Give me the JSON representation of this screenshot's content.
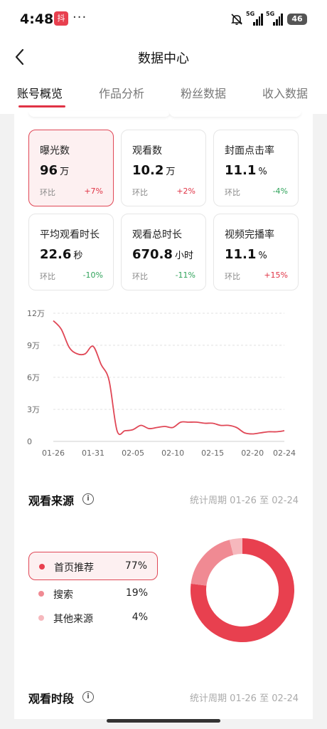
{
  "status_bar": {
    "time": "4:48",
    "app_badge": "抖",
    "more": "···",
    "network_1": "5G",
    "network_2": "5G",
    "battery": "46"
  },
  "nav": {
    "title": "数据中心"
  },
  "tabs": [
    {
      "label": "账号概览",
      "active": true
    },
    {
      "label": "作品分析",
      "active": false
    },
    {
      "label": "粉丝数据",
      "active": false
    },
    {
      "label": "收入数据",
      "active": false
    }
  ],
  "metrics": [
    {
      "label": "曝光数",
      "value": "96",
      "unit": "万",
      "compare_label": "环比",
      "change": "+7%",
      "trend": "up",
      "selected": true
    },
    {
      "label": "观看数",
      "value": "10.2",
      "unit": "万",
      "compare_label": "环比",
      "change": "+2%",
      "trend": "up",
      "selected": false
    },
    {
      "label": "封面点击率",
      "value": "11.1",
      "unit": "%",
      "compare_label": "环比",
      "change": "-4%",
      "trend": "down",
      "selected": false
    },
    {
      "label": "平均观看时长",
      "value": "22.6",
      "unit": "秒",
      "compare_label": "环比",
      "change": "-10%",
      "trend": "down",
      "selected": false
    },
    {
      "label": "观看总时长",
      "value": "670.8",
      "unit": "小时",
      "compare_label": "环比",
      "change": "-11%",
      "trend": "down",
      "selected": false
    },
    {
      "label": "视频完播率",
      "value": "11.1",
      "unit": "%",
      "compare_label": "环比",
      "change": "+15%",
      "trend": "up",
      "selected": false
    }
  ],
  "chart_data": {
    "type": "line",
    "ylim": [
      0,
      120000
    ],
    "y_ticks": [
      "0",
      "3万",
      "6万",
      "9万",
      "12万"
    ],
    "x_ticks": [
      "01-26",
      "01-31",
      "02-05",
      "02-10",
      "02-15",
      "02-20",
      "02-24"
    ],
    "grid": true,
    "color": "#e04756",
    "x": [
      "01-26",
      "01-27",
      "01-28",
      "01-29",
      "01-30",
      "01-31",
      "02-01",
      "02-02",
      "02-03",
      "02-04",
      "02-05",
      "02-06",
      "02-07",
      "02-08",
      "02-09",
      "02-10",
      "02-11",
      "02-12",
      "02-13",
      "02-14",
      "02-15",
      "02-16",
      "02-17",
      "02-18",
      "02-19",
      "02-20",
      "02-21",
      "02-22",
      "02-23",
      "02-24"
    ],
    "values": [
      113000,
      105000,
      88000,
      82000,
      82000,
      89000,
      72000,
      57000,
      10000,
      10000,
      11000,
      15000,
      12000,
      13000,
      14000,
      13000,
      18000,
      18000,
      18000,
      17000,
      17000,
      15000,
      15000,
      13000,
      8000,
      7000,
      8000,
      9000,
      9000,
      10000
    ]
  },
  "source_section": {
    "title": "观看来源",
    "info": "i",
    "period": "统计周期 01-26 至 02-24",
    "items": [
      {
        "name": "首页推荐",
        "percent": "77%",
        "value": 77,
        "color": "#e8404f",
        "selected": true
      },
      {
        "name": "搜索",
        "percent": "19%",
        "value": 19,
        "color": "#f08a93",
        "selected": false
      },
      {
        "name": "其他来源",
        "percent": "4%",
        "value": 4,
        "color": "#f6b8bd",
        "selected": false
      }
    ]
  },
  "time_section": {
    "title": "观看时段",
    "info": "i",
    "period": "统计周期 01-26 至 02-24"
  }
}
